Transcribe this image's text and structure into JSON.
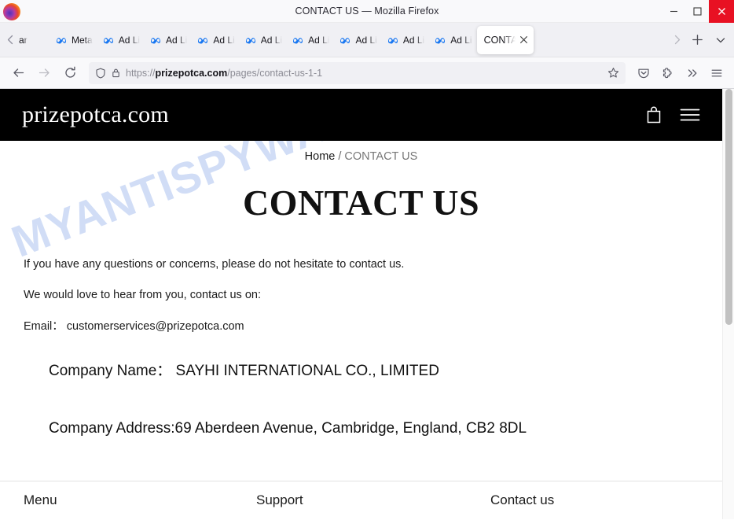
{
  "window": {
    "title": "CONTACT US — Mozilla Firefox",
    "minimize_label": "Minimize",
    "maximize_label": "Maximize",
    "close_label": "Close"
  },
  "tabs": {
    "scroll_left_label": "Scroll tabs left",
    "scroll_right_label": "Scroll tabs right",
    "new_tab_label": "New tab",
    "list_all_label": "List all tabs",
    "items": [
      {
        "label": "ar",
        "icon": "meta-icon",
        "active": false,
        "clipped": true
      },
      {
        "label": "Meta",
        "icon": "meta-icon",
        "active": false,
        "clipped": false
      },
      {
        "label": "Ad Li",
        "icon": "meta-icon",
        "active": false,
        "clipped": false
      },
      {
        "label": "Ad Li",
        "icon": "meta-icon",
        "active": false,
        "clipped": false
      },
      {
        "label": "Ad Li",
        "icon": "meta-icon",
        "active": false,
        "clipped": false
      },
      {
        "label": "Ad Li",
        "icon": "meta-icon",
        "active": false,
        "clipped": false
      },
      {
        "label": "Ad Li",
        "icon": "meta-icon",
        "active": false,
        "clipped": false
      },
      {
        "label": "Ad Li",
        "icon": "meta-icon",
        "active": false,
        "clipped": false
      },
      {
        "label": "Ad Li",
        "icon": "meta-icon",
        "active": false,
        "clipped": false
      },
      {
        "label": "Ad Li",
        "icon": "meta-icon",
        "active": false,
        "clipped": false
      },
      {
        "label": "CONTA",
        "icon": "none",
        "active": true,
        "clipped": false
      }
    ]
  },
  "navbar": {
    "back_label": "Back",
    "forward_label": "Forward",
    "reload_label": "Reload",
    "url_prefix": "https://",
    "url_domain": "prizepotca.com",
    "url_path": "/pages/contact-us-1-1",
    "url_full": "https://prizepotca.com/pages/contact-us-1-1",
    "bookmark_label": "Bookmark this page",
    "shield_label": "Tracking protection",
    "lock_label": "Connection secure",
    "save_to_pocket_label": "Save to Pocket",
    "extensions_label": "Extensions",
    "overflow_label": "More tools",
    "app_menu_label": "Open application menu"
  },
  "site": {
    "logo": "prizepotca.com",
    "cart_label": "Cart",
    "menu_label": "Menu"
  },
  "breadcrumb": {
    "home": "Home",
    "separator": "/",
    "current": "CONTACT US"
  },
  "page": {
    "title": "CONTACT US",
    "paragraph_1": "If you have any questions or concerns, please do not hesitate to contact us.",
    "paragraph_2": "We would love to hear from you, contact us on:",
    "email_line": "Email： customerservices@prizepotca.com",
    "company_name_line": "Company Name： SAYHI INTERNATIONAL CO., LIMITED",
    "company_address_line": "Company Address:69 Aberdeen Avenue, Cambridge, England, CB2 8DL"
  },
  "watermark": {
    "text": "MYANTISPYWARE.COM",
    "color": "#c9d8f5"
  },
  "footer": {
    "columns": [
      {
        "label": "Menu"
      },
      {
        "label": "Support"
      },
      {
        "label": "Contact us"
      }
    ]
  },
  "theme": {
    "header_bg": "#000000",
    "close_button": "#e81123",
    "meta_blue": "#1877f2",
    "chrome_bg": "#f0f0f4"
  }
}
